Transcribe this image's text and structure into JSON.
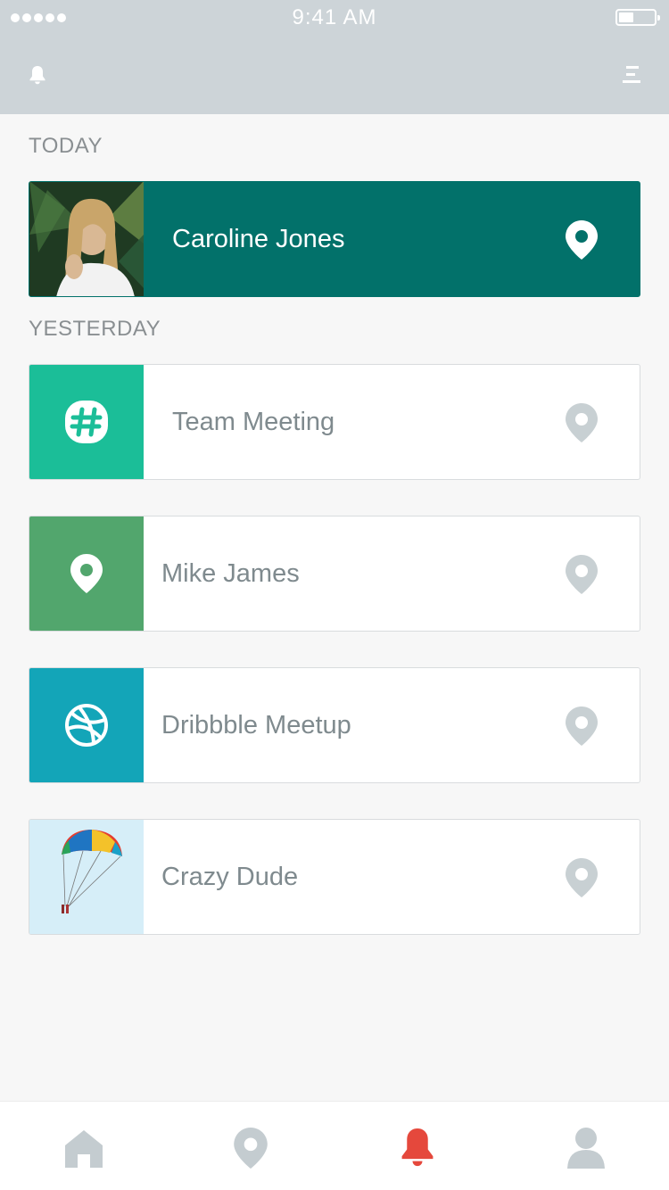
{
  "status_bar": {
    "time": "9:41 AM",
    "signal_icon": "signal-dots-icon",
    "battery_icon": "battery-icon"
  },
  "header": {
    "left_icon": "bell-icon",
    "right_icon": "menu-icon"
  },
  "sections": [
    {
      "label": "TODAY",
      "items": [
        {
          "title": "Caroline Jones",
          "thumb": "photo-woman",
          "pin_icon": "location-pin-icon"
        }
      ]
    },
    {
      "label": "YESTERDAY",
      "items": [
        {
          "title": "Team Meeting",
          "thumb": "slack-hash-icon",
          "pin_icon": "location-pin-icon"
        },
        {
          "title": "Mike James",
          "thumb": "location-pin-icon",
          "pin_icon": "location-pin-icon"
        },
        {
          "title": "Dribbble Meetup",
          "thumb": "dribbble-icon",
          "pin_icon": "location-pin-icon"
        },
        {
          "title": "Crazy Dude",
          "thumb": "photo-parasail",
          "pin_icon": "location-pin-icon"
        }
      ]
    }
  ],
  "bottom_nav": [
    {
      "icon": "home-icon",
      "active": false
    },
    {
      "icon": "location-pin-icon",
      "active": false
    },
    {
      "icon": "bell-icon",
      "active": true
    },
    {
      "icon": "profile-icon",
      "active": false
    }
  ],
  "colors": {
    "header_bg": "#cdd4d8",
    "active_card": "#02716a",
    "team_meeting": "#1bbe98",
    "mike_james": "#52a66d",
    "dribbble": "#13a5b8",
    "active_nav": "#e5483c",
    "inactive_nav": "#c4ccd0"
  }
}
